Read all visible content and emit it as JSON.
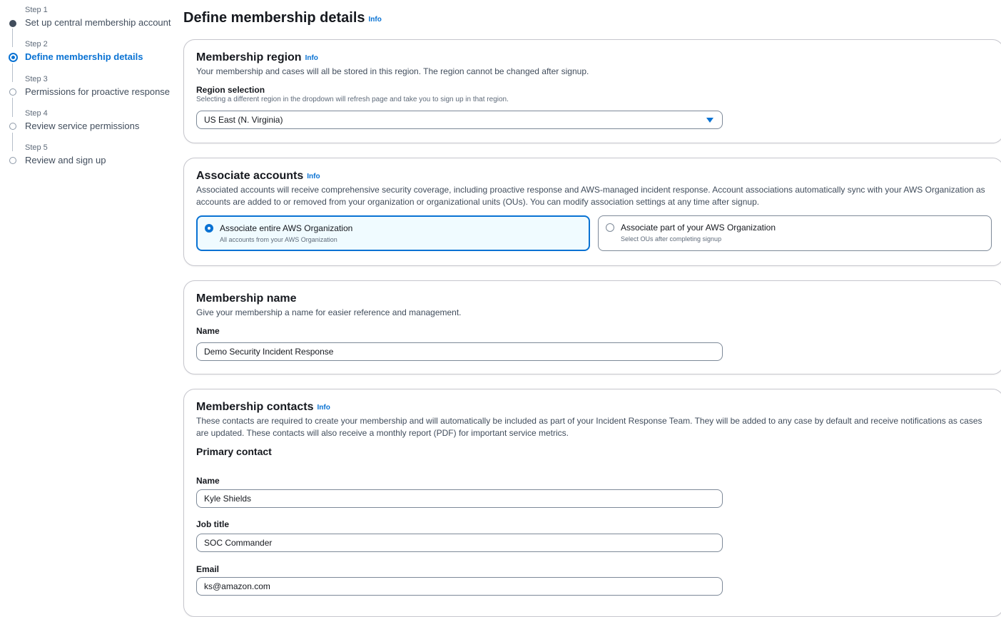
{
  "stepper": {
    "steps": [
      {
        "number": "Step 1",
        "title": "Set up central membership account",
        "state": "completed"
      },
      {
        "number": "Step 2",
        "title": "Define membership details",
        "state": "current"
      },
      {
        "number": "Step 3",
        "title": "Permissions for proactive response",
        "state": "pending"
      },
      {
        "number": "Step 4",
        "title": "Review service permissions",
        "state": "pending"
      },
      {
        "number": "Step 5",
        "title": "Review and sign up",
        "state": "pending"
      }
    ]
  },
  "page": {
    "title": "Define membership details",
    "info": "Info"
  },
  "region": {
    "title": "Membership region",
    "info": "Info",
    "description": "Your membership and cases will all be stored in this region. The region cannot be changed after signup.",
    "label": "Region selection",
    "hint": "Selecting a different region in the dropdown will refresh page and take you to sign up in that region.",
    "selected": "US East (N. Virginia)"
  },
  "associate": {
    "title": "Associate accounts",
    "info": "Info",
    "description": "Associated accounts will receive comprehensive security coverage, including proactive response and AWS-managed incident response. Account associations automatically sync with your AWS Organization as accounts are added to or removed from your organization or organizational units (OUs). You can modify association settings at any time after signup.",
    "options": [
      {
        "title": "Associate entire AWS Organization",
        "subtitle": "All accounts from your AWS Organization",
        "selected": true
      },
      {
        "title": "Associate part of your AWS Organization",
        "subtitle": "Select OUs after completing signup",
        "selected": false
      }
    ]
  },
  "name_section": {
    "title": "Membership name",
    "description": "Give your membership a name for easier reference and management.",
    "label": "Name",
    "value": "Demo Security Incident Response"
  },
  "contacts": {
    "title": "Membership contacts",
    "info": "Info",
    "description": "These contacts are required to create your membership and will automatically be included as part of your Incident Response Team. They will be added to any case by default and receive notifications as cases are updated. These contacts will also receive a monthly report (PDF) for important service metrics.",
    "primary_heading": "Primary contact",
    "name_label": "Name",
    "name_value": "Kyle Shields",
    "job_label": "Job title",
    "job_value": "SOC Commander",
    "email_label": "Email",
    "email_value": "ks@amazon.com"
  },
  "colors": {
    "accent": "#0972d3",
    "selected_tile_bg": "#f0fbff",
    "border": "#7d8998"
  }
}
